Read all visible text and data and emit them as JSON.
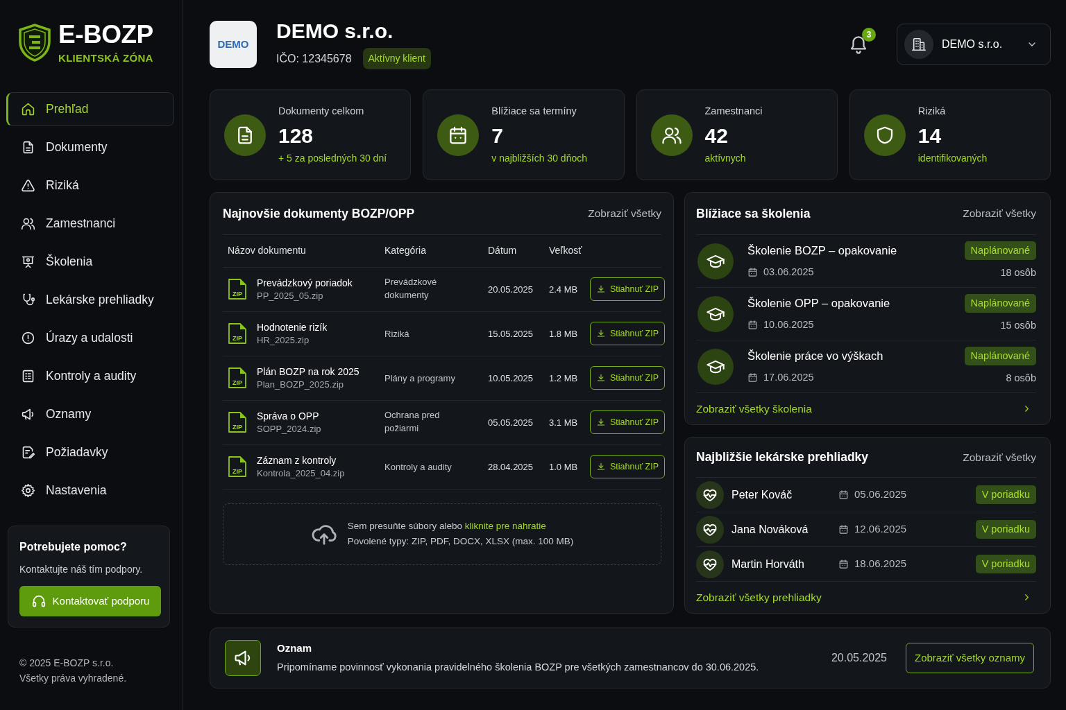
{
  "brand": {
    "name": "E-BOZP",
    "subtitle": "KLIENTSKÁ ZÓNA"
  },
  "sidebar": {
    "items": [
      {
        "label": "Prehľad",
        "selected": true
      },
      {
        "label": "Dokumenty",
        "selected": false
      },
      {
        "label": "Riziká",
        "selected": false
      },
      {
        "label": "Zamestnanci",
        "selected": false
      },
      {
        "label": "Školenia",
        "selected": false
      },
      {
        "label": "Lekárske prehliadky",
        "selected": false
      },
      {
        "label": "Úrazy a udalosti",
        "selected": false
      },
      {
        "label": "Kontroly a audity",
        "selected": false
      },
      {
        "label": "Oznamy",
        "selected": false
      },
      {
        "label": "Požiadavky",
        "selected": false
      },
      {
        "label": "Nastavenia",
        "selected": false
      }
    ],
    "help": {
      "title": "Potrebujete pomoc?",
      "text": "Kontaktujte náš tím podpory.",
      "button": "Kontaktovať podporu"
    },
    "footer": {
      "copyright": "© 2025 E-BOZP s.r.o.",
      "rights": "Všetky práva vyhradené."
    }
  },
  "header": {
    "logo_text": "DEMO",
    "company": "DEMO s.r.o.",
    "ico": "IČO: 12345678",
    "status": "Aktívny klient",
    "notification_count": "3",
    "account": "DEMO s.r.o."
  },
  "stats": [
    {
      "label": "Dokumenty celkom",
      "value": "128",
      "note": "+ 5 za posledných 30 dní"
    },
    {
      "label": "Blížiace sa termíny",
      "value": "7",
      "note": "v najbližších 30 dňoch"
    },
    {
      "label": "Zamestnanci",
      "value": "42",
      "note": "aktívnych"
    },
    {
      "label": "Riziká",
      "value": "14",
      "note": "identifikovaných"
    }
  ],
  "documents": {
    "title": "Najnovšie dokumenty BOZP/OPP",
    "view_all": "Zobraziť všetky",
    "columns": [
      "Názov dokumentu",
      "Kategória",
      "Dátum",
      "Veľkosť"
    ],
    "rows": [
      {
        "type": "ZIP",
        "name": "Prevádzkový poriadok",
        "file": "PP_2025_05.zip",
        "category": "Prevádzkové dokumenty",
        "date": "20.05.2025",
        "size": "2.4 MB",
        "action": "Stiahnuť ZIP"
      },
      {
        "type": "ZIP",
        "name": "Hodnotenie rizík",
        "file": "HR_2025.zip",
        "category": "Riziká",
        "date": "15.05.2025",
        "size": "1.8 MB",
        "action": "Stiahnuť ZIP"
      },
      {
        "type": "ZIP",
        "name": "Plán BOZP na rok 2025",
        "file": "Plan_BOZP_2025.zip",
        "category": "Plány a programy",
        "date": "10.05.2025",
        "size": "1.2 MB",
        "action": "Stiahnuť ZIP"
      },
      {
        "type": "ZIP",
        "name": "Správa o OPP",
        "file": "SOPP_2024.zip",
        "category": "Ochrana pred požiarmi",
        "date": "05.05.2025",
        "size": "3.1 MB",
        "action": "Stiahnuť ZIP"
      },
      {
        "type": "ZIP",
        "name": "Záznam z kontroly",
        "file": "Kontrola_2025_04.zip",
        "category": "Kontroly a audity",
        "date": "28.04.2025",
        "size": "1.0 MB",
        "action": "Stiahnuť ZIP"
      }
    ],
    "upload": {
      "text": "Sem presuňte súbory alebo",
      "link": "kliknite pre nahratie",
      "hint": "Povolené typy: ZIP, PDF, DOCX, XLSX (max. 100 MB)"
    }
  },
  "trainings": {
    "title": "Blížiace sa školenia",
    "view_all": "Zobraziť všetky",
    "items": [
      {
        "title": "Školenie BOZP – opakovanie",
        "date": "03.06.2025",
        "status": "Naplánované",
        "attendees": "18 osôb"
      },
      {
        "title": "Školenie OPP – opakovanie",
        "date": "10.06.2025",
        "status": "Naplánované",
        "attendees": "15 osôb"
      },
      {
        "title": "Školenie práce vo výškach",
        "date": "17.06.2025",
        "status": "Naplánované",
        "attendees": "8 osôb"
      }
    ],
    "footer_link": "Zobraziť všetky školenia"
  },
  "medical": {
    "title": "Najbližšie lekárske prehliadky",
    "view_all": "Zobraziť všetky",
    "items": [
      {
        "name": "Peter Kováč",
        "date": "05.06.2025",
        "status": "V poriadku"
      },
      {
        "name": "Jana Nováková",
        "date": "12.06.2025",
        "status": "V poriadku"
      },
      {
        "name": "Martin Horváth",
        "date": "18.06.2025",
        "status": "V poriadku"
      }
    ],
    "footer_link": "Zobraziť všetky prehliadky"
  },
  "announcement": {
    "title": "Oznam",
    "text": "Pripomíname povinnosť vykonania pravidelného školenia BOZP pre všetkých zamestnancov do 30.06.2025.",
    "date": "20.05.2025",
    "button": "Zobraziť všetky oznamy"
  }
}
